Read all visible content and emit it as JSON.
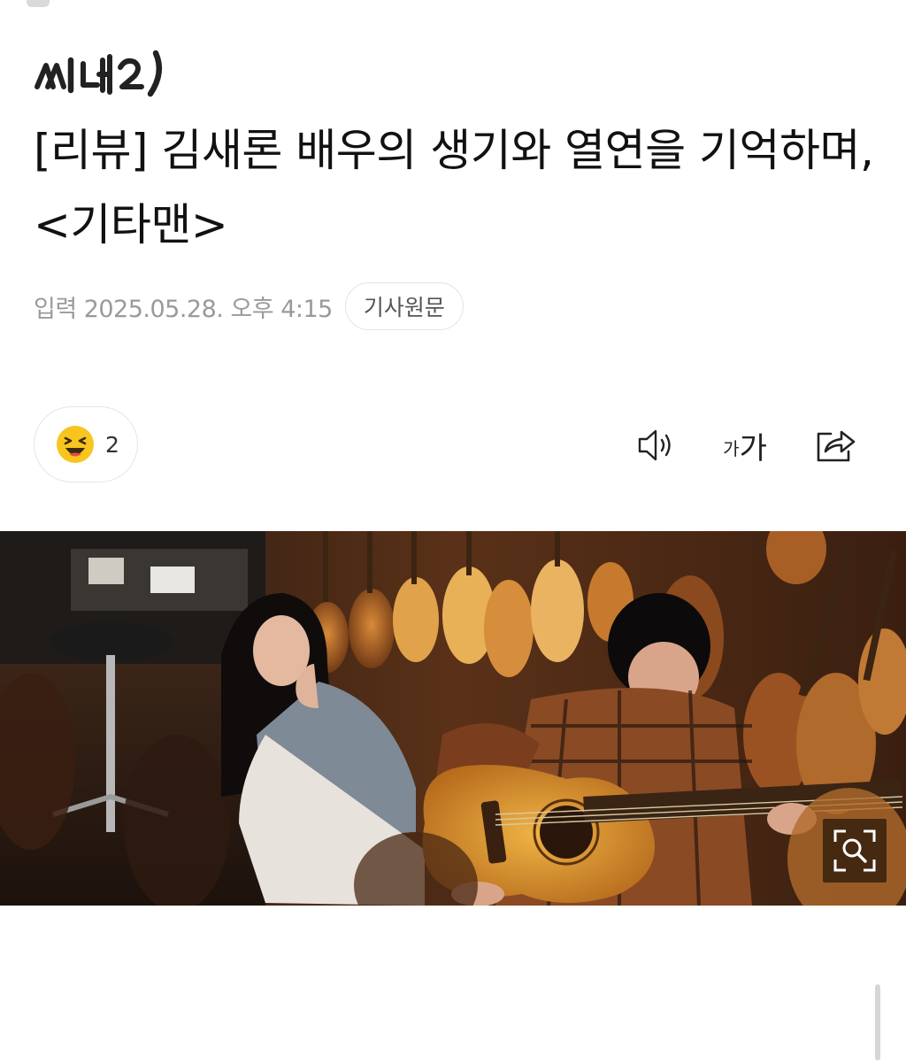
{
  "publication": {
    "logo_text": "씨네21"
  },
  "article": {
    "title": "[리뷰] 김새론 배우의 생기와 열연을 기억하며, <기타맨>",
    "published_label": "입력",
    "published_datetime": "2025.05.28. 오후 4:15",
    "original_link_label": "기사원문"
  },
  "reactions": {
    "icon": "laughing-face-icon",
    "count": "2"
  },
  "toolbar": {
    "listen_icon": "speaker-icon",
    "font_size_small": "가",
    "font_size_large": "가",
    "share_icon": "share-icon"
  },
  "image": {
    "alt": "기타맨 스틸컷",
    "zoom_icon": "zoom-icon"
  },
  "colors": {
    "title_text": "#111111",
    "meta_text": "#9a9a9a",
    "pill_border": "#e5e5e5",
    "emoji_yellow": "#f7c51e"
  }
}
